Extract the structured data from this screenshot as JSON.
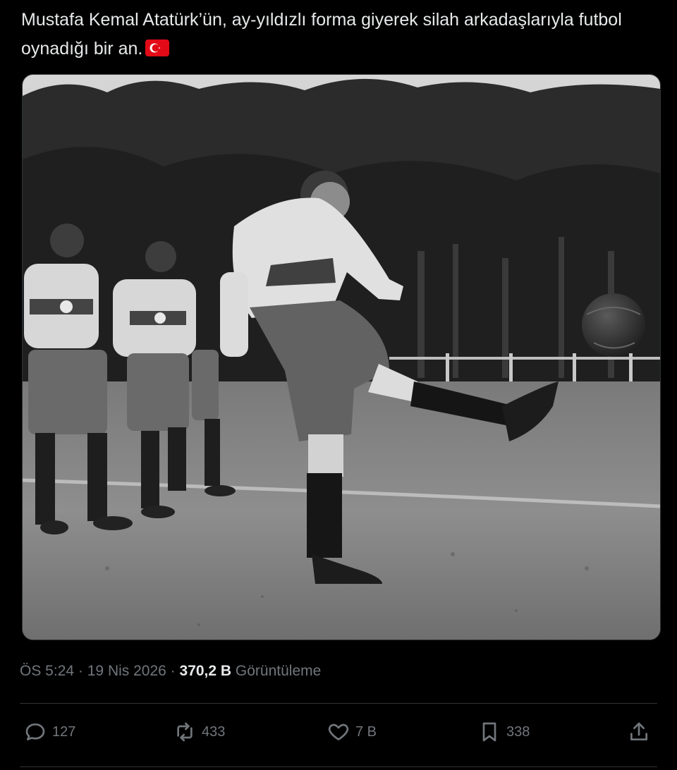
{
  "tweet": {
    "text": "Mustafa Kemal Atatürk’ün, ay-yıldızlı forma giyerek silah arkadaşlarıyla futbol oynadığı bir an.",
    "flag_icon": "turkey-flag-emoji",
    "flag_colors": {
      "red": "#e30a17",
      "white": "#ffffff"
    }
  },
  "media": {
    "kind": "black-and-white photograph"
  },
  "meta": {
    "time": "ÖS 5:24",
    "separator": "·",
    "date": "19 Nis 2026",
    "views_count": "370,2 B",
    "views_label": "Görüntüleme"
  },
  "actions": {
    "reply": {
      "icon": "reply-icon",
      "count": "127"
    },
    "repost": {
      "icon": "repost-icon",
      "count": "433"
    },
    "like": {
      "icon": "heart-icon",
      "count": "7 B"
    },
    "bookmark": {
      "icon": "bookmark-icon",
      "count": "338"
    },
    "share": {
      "icon": "share-icon"
    }
  },
  "colors": {
    "background": "#000000",
    "text": "#e7e9ea",
    "secondary_text": "#71767b",
    "divider": "#2f3336"
  }
}
